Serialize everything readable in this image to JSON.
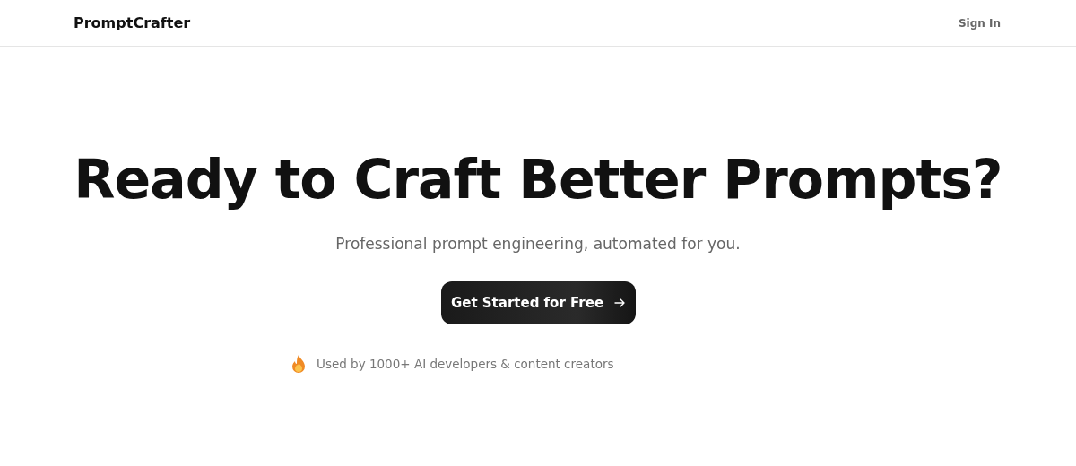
{
  "header": {
    "logo": "PromptCrafter",
    "sign_in": "Sign In"
  },
  "hero": {
    "title": "Ready to Craft Better Prompts?",
    "subtitle": "Professional prompt engineering, automated for you.",
    "cta": "Get Started for Free",
    "social_proof": "Used by 1000+ AI developers & content creators"
  }
}
